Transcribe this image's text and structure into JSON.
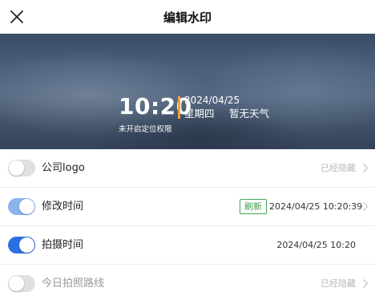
{
  "header": {
    "title": "编辑水印",
    "close_icon": "close-icon"
  },
  "preview": {
    "time": "10:20",
    "date": "2024/04/25",
    "weekday": "星期四",
    "weather": "暂无天气",
    "location_status": "未开启定位权限",
    "accent_color": "#f1a43a"
  },
  "settings": [
    {
      "label": "公司logo",
      "enabled": false,
      "value": "已经隐藏",
      "has_chevron": true
    },
    {
      "label": "修改时间",
      "enabled": true,
      "badge": "刷新",
      "value": "2024/04/25 10:20:39",
      "has_chevron": true
    },
    {
      "label": "拍摄时间",
      "enabled": true,
      "value": "2024/04/25 10:20",
      "has_chevron": false
    },
    {
      "label": "今日拍照路线",
      "enabled": false,
      "value": "已经隐藏",
      "has_chevron": true
    }
  ],
  "colors": {
    "toggle_on": "#2c6fe4",
    "toggle_on_light": "#8bb4ef",
    "toggle_off": "#e0e0e0",
    "refresh_green": "#3c9b4e"
  }
}
